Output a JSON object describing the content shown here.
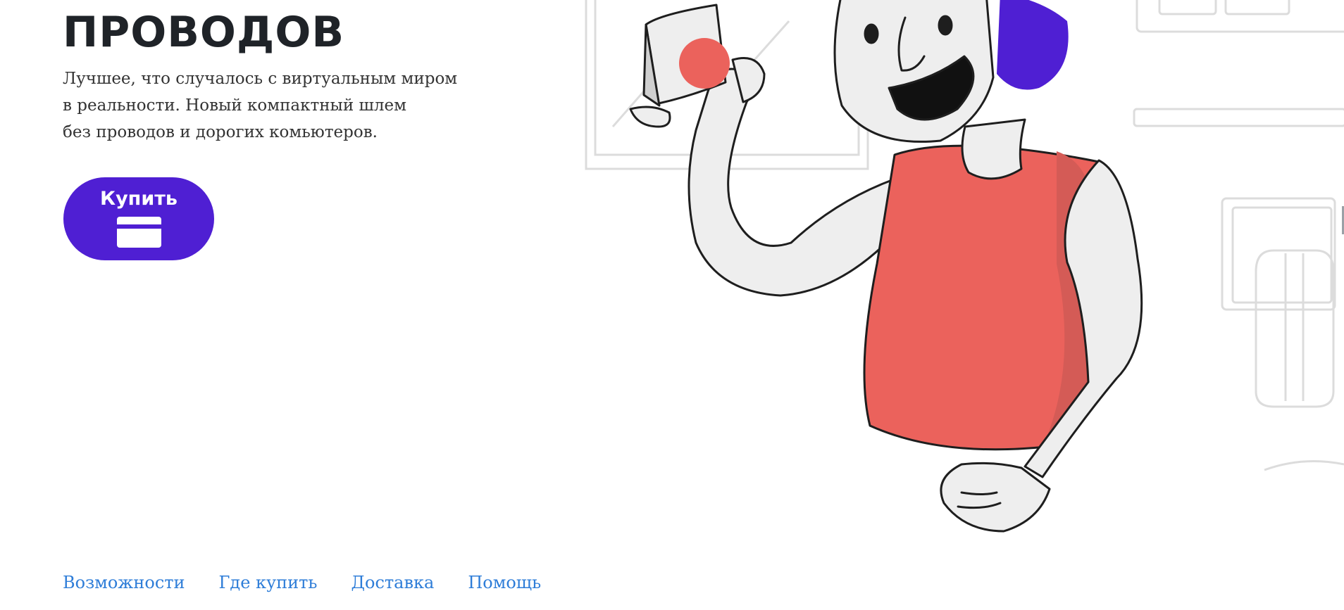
{
  "hero": {
    "title": "ПРОВОДОВ",
    "description_lines": [
      "Лучшее, что случалось с виртуальным миром",
      "в реальности. Новый компактный шлем",
      "без проводов и дорогих комьютеров."
    ],
    "buy_label": "Купить",
    "buy_icon": "credit-card-icon"
  },
  "footer_nav": [
    {
      "label": "Возможности"
    },
    {
      "label": "Где купить"
    },
    {
      "label": "Доставка"
    },
    {
      "label": "Помощь"
    }
  ],
  "colors": {
    "brand": "#4f1fd3",
    "link": "#2e7dd8",
    "shirt": "#eb625c"
  }
}
